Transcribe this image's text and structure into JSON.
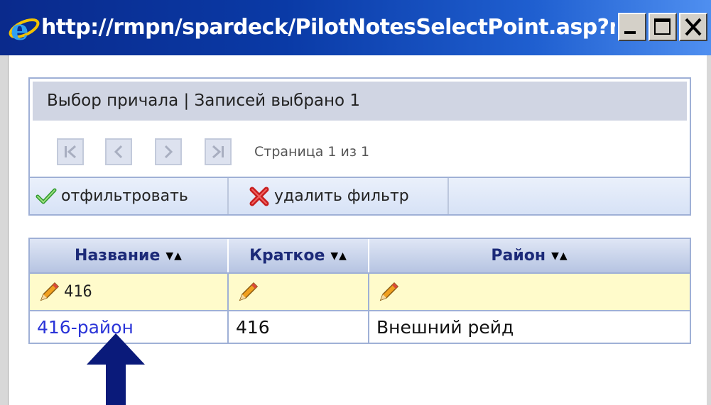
{
  "window": {
    "title": "http://rmpn/spardeck/PilotNotesSelectPoint.asp?n..."
  },
  "panel": {
    "title": "Выбор причала | Записей выбрано 1",
    "page_info": "Страница 1 из 1",
    "filter_label": "отфильтровать",
    "clear_filter_label": "удалить фильтр"
  },
  "grid": {
    "columns": [
      "Название",
      "Краткое",
      "Район"
    ],
    "sort_glyph": "▼▲",
    "filter_values": [
      "416",
      "",
      ""
    ],
    "rows": [
      {
        "name": "416-район",
        "short": "416",
        "district": "Внешний рейд"
      }
    ]
  },
  "colors": {
    "title_bar": "#0a2a8c",
    "header_text": "#1c2a78",
    "link": "#2a34d8",
    "filter_row": "#fffbcb",
    "arrow": "#0a1a7a"
  },
  "icons": {
    "title": "ie-icon",
    "filter": "check-icon",
    "clear_filter": "red-x-icon",
    "filter_cells": "pencil-icon",
    "pager": [
      "first-page-icon",
      "prev-page-icon",
      "next-page-icon",
      "last-page-icon"
    ],
    "annotation": "up-arrow-icon"
  }
}
